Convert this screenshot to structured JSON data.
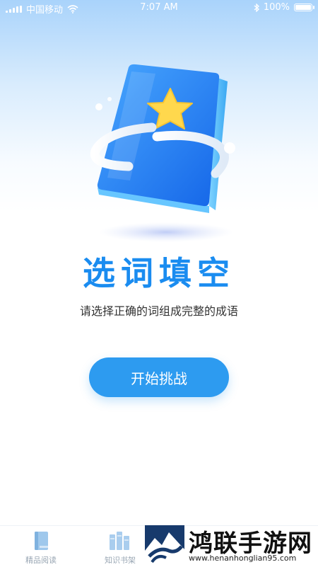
{
  "status_bar": {
    "carrier": "中国移动",
    "time": "7:07 AM",
    "battery": "100%",
    "battery_level": 1.0
  },
  "main": {
    "title": "选词填空",
    "subtitle": "请选择正确的词组成完整的成语",
    "start_button": "开始挑战"
  },
  "tabbar": {
    "items": [
      {
        "label": "精品阅读",
        "icon": "book-icon"
      },
      {
        "label": "知识书架",
        "icon": "bookshelf-icon"
      }
    ]
  },
  "watermark": {
    "name": "鸿联手游网",
    "url": "www.henanhonglian95.com"
  },
  "colors": {
    "accent": "#2d9bf0",
    "title": "#1a8cf0",
    "tab_inactive": "#9aa7b4"
  }
}
